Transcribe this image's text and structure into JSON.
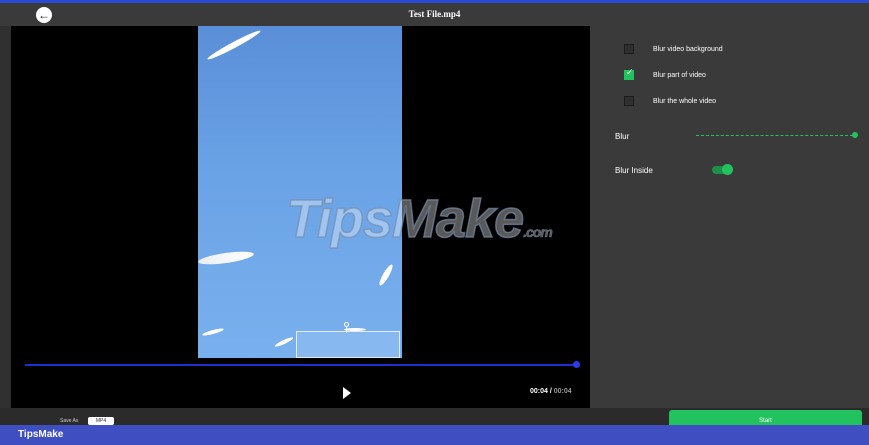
{
  "window": {
    "title": "Test File.mp4"
  },
  "video": {
    "watermark_main": "TipsMake",
    "watermark_suffix": ".com",
    "progress": 1.0,
    "time_current": "00:04",
    "time_separator": " / ",
    "time_total": "00:04"
  },
  "options": {
    "blur_background_label": "Blur video background",
    "blur_background_checked": false,
    "blur_part_label": "Blur part of video",
    "blur_part_checked": true,
    "blur_whole_label": "Blur the whole video",
    "blur_whole_checked": false
  },
  "controls": {
    "blur_label": "Blur",
    "blur_value": 1.0,
    "blur_inside_label": "Blur Inside",
    "blur_inside_on": true
  },
  "bottom": {
    "save_as_label": "Save As",
    "format_value": "MP4",
    "start_label": "Start"
  },
  "footer": {
    "brand": "TipsMake"
  },
  "colors": {
    "accent": "#22c35e",
    "timeline": "#1e2fd0",
    "footer": "#3f4fc2"
  },
  "icons": {
    "back": "arrow-left-circle-icon",
    "play": "play-icon",
    "check": "checkmark-icon"
  }
}
